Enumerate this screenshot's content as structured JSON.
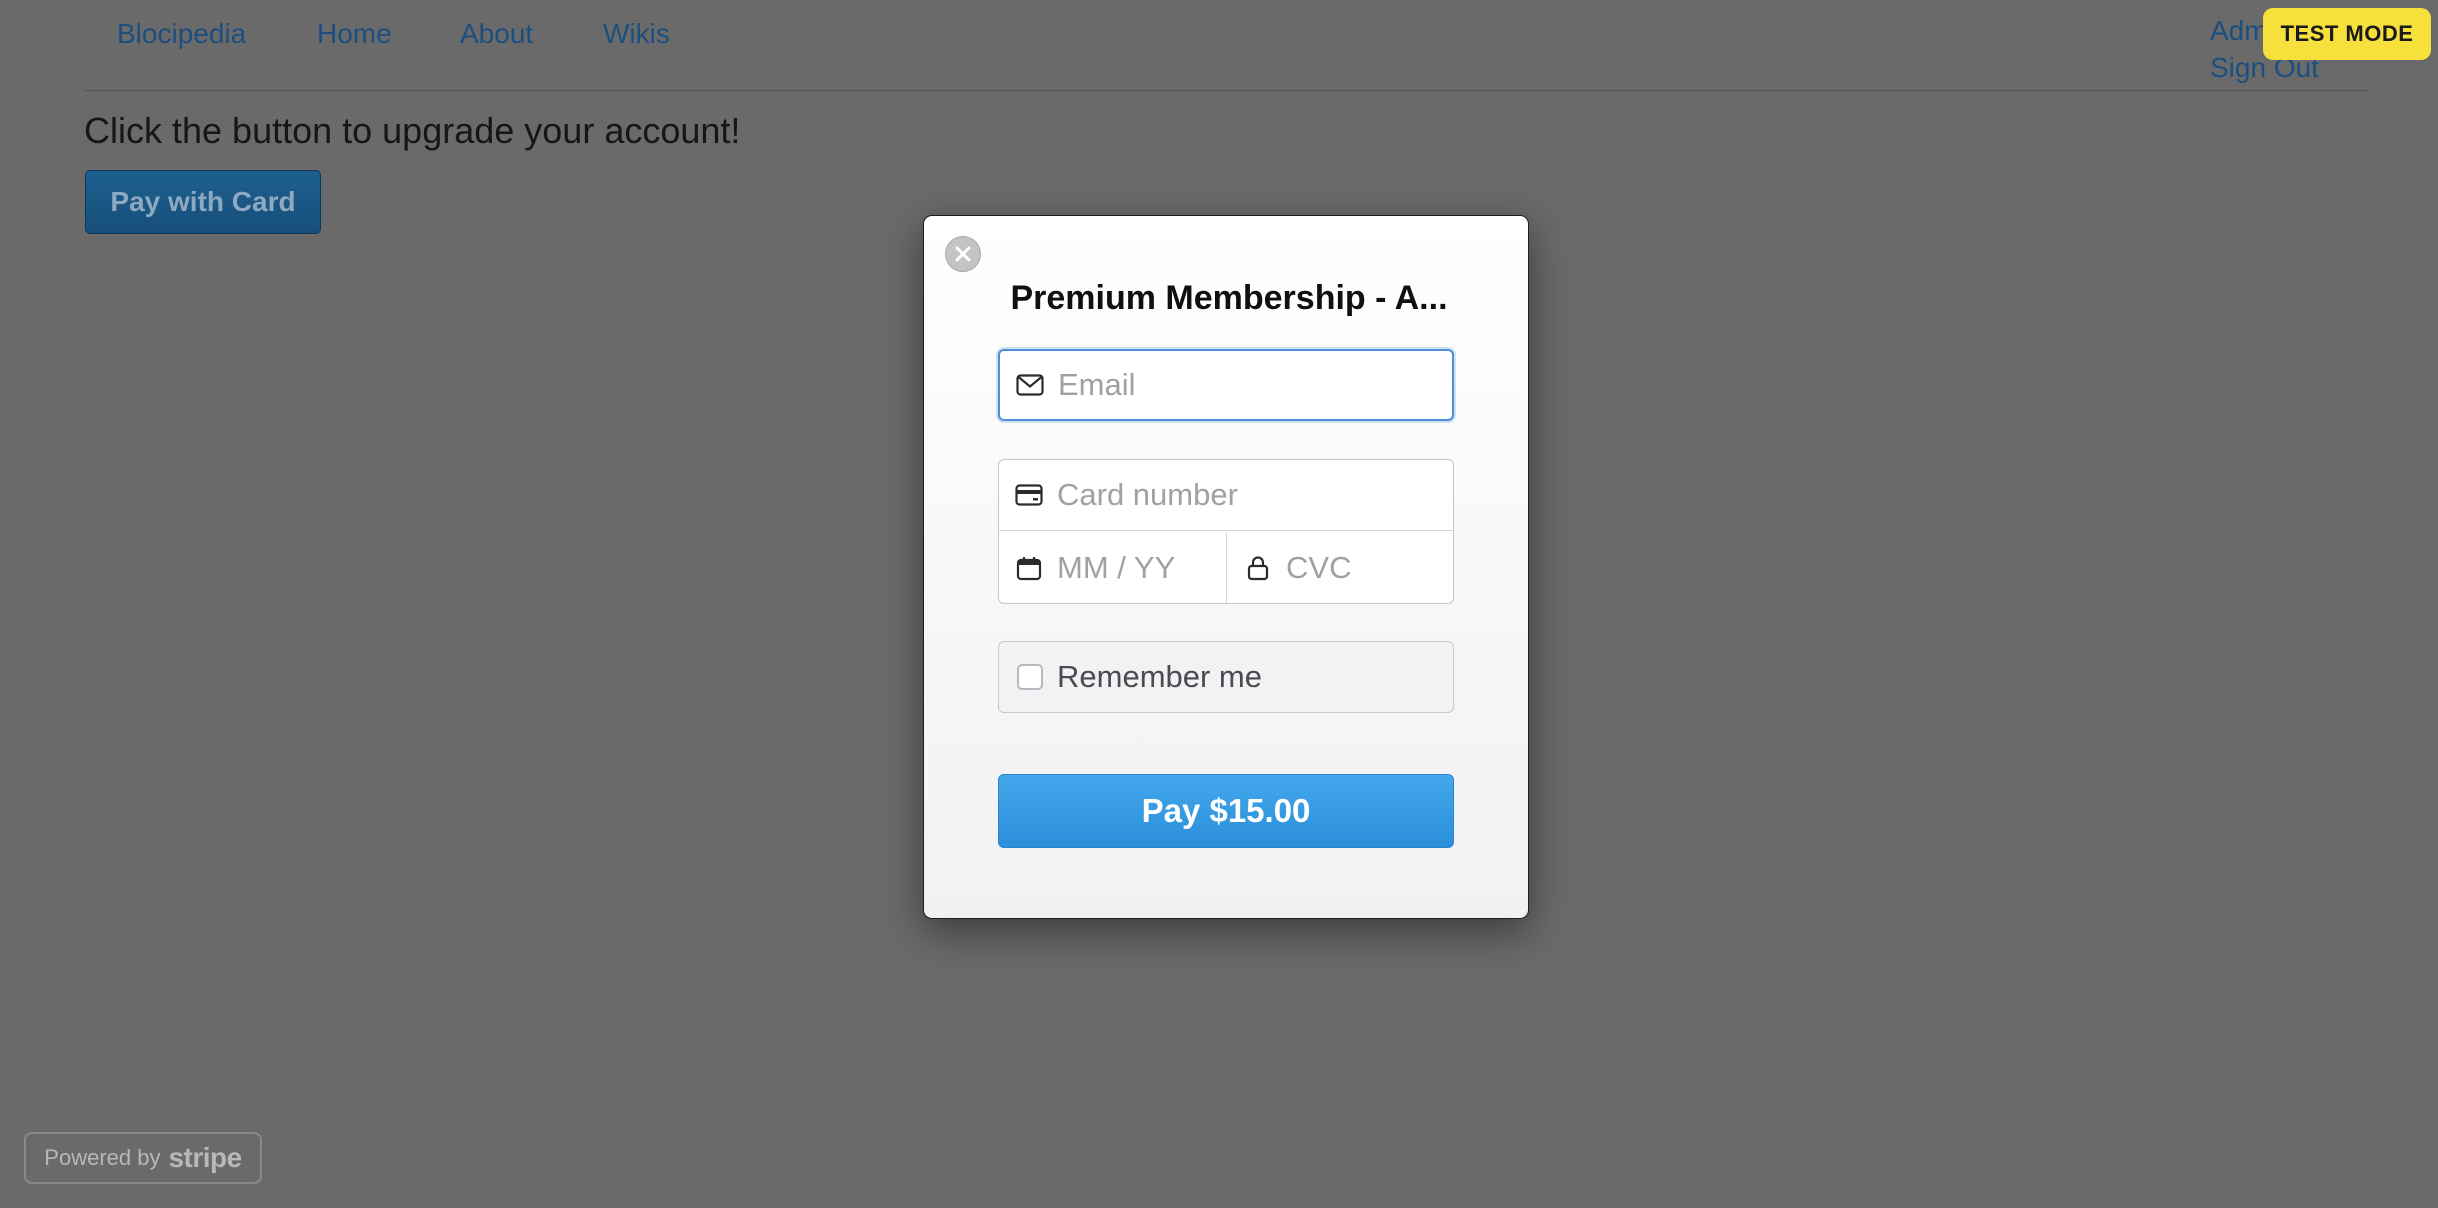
{
  "nav": {
    "brand": "Blocipedia",
    "links": [
      "Home",
      "About",
      "Wikis"
    ],
    "user_links": [
      "Admin",
      "Sign Out"
    ]
  },
  "page": {
    "headline": "Click the button to upgrade your account!",
    "pay_card_button": "Pay with Card"
  },
  "badge": {
    "test_mode": "TEST MODE",
    "color": "#f5e03c"
  },
  "checkout": {
    "title": "Premium Membership - A...",
    "email_placeholder": "Email",
    "card_number_placeholder": "Card number",
    "expiry_placeholder": "MM / YY",
    "cvc_placeholder": "CVC",
    "remember_label": "Remember me",
    "pay_button": "Pay $15.00",
    "accent_color": "#3a9ee6"
  },
  "footer": {
    "powered_by": "Powered by",
    "brand": "stripe"
  },
  "icons": [
    "close-icon",
    "email-icon",
    "credit-card-icon",
    "calendar-icon",
    "lock-icon"
  ]
}
